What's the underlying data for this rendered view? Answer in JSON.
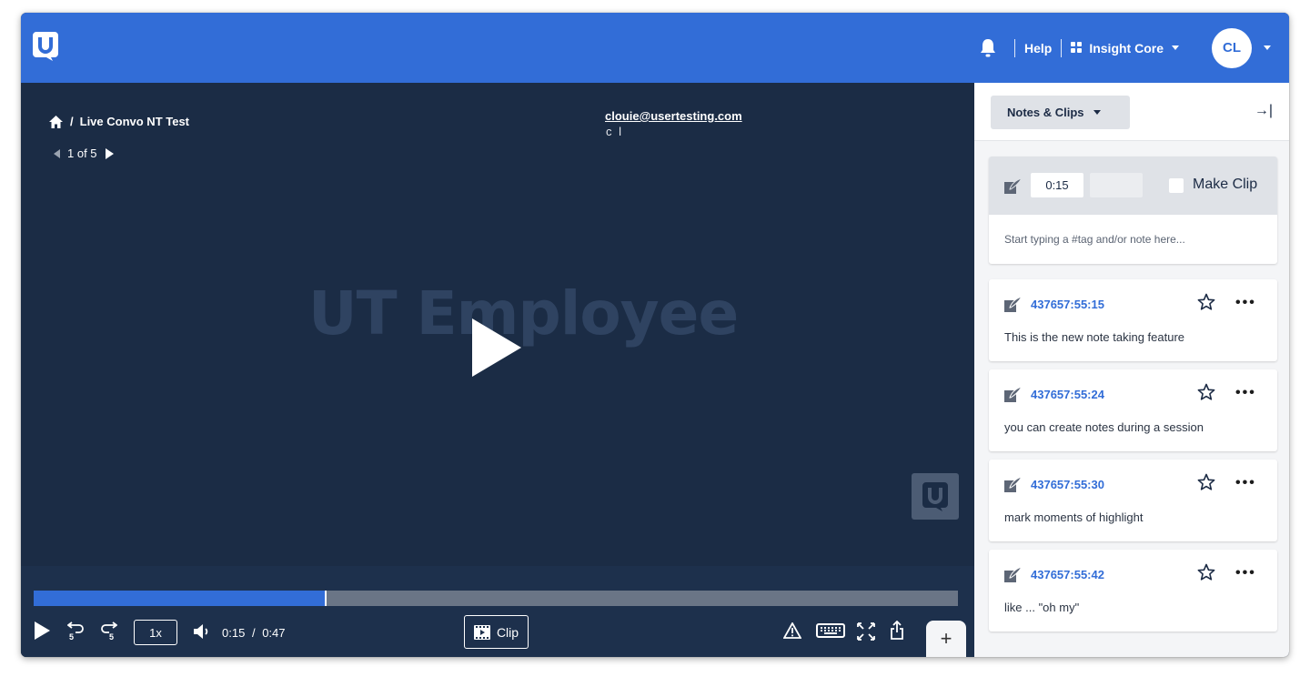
{
  "header": {
    "help_label": "Help",
    "workspace_label": "Insight Core",
    "avatar_initials": "CL"
  },
  "video": {
    "breadcrumb_title": "Live Convo NT Test",
    "pager_text": "1 of 5",
    "participant_email": "clouie@usertesting.com",
    "participant_initials": "c l",
    "watermark_text": "UT Employee",
    "progress_fraction": 0.315,
    "speed_label": "1x",
    "current_time": "0:15",
    "time_separator": "/",
    "duration": "0:47",
    "clip_label": "Clip",
    "add_label": "+"
  },
  "panel": {
    "view_dropdown_label": "Notes & Clips",
    "collapse_label": "→|",
    "composer": {
      "start_time": "0:15",
      "end_time": "",
      "make_clip_label": "Make Clip",
      "make_clip_checked": false,
      "note_placeholder": "Start typing a #tag and/or note here..."
    },
    "notes": [
      {
        "timestamp": "437657:55:15",
        "text": "This is the new note taking feature"
      },
      {
        "timestamp": "437657:55:24",
        "text": "you can create notes during a session"
      },
      {
        "timestamp": "437657:55:30",
        "text": "mark moments of highlight"
      },
      {
        "timestamp": "437657:55:42",
        "text": "like ... \"oh my\""
      }
    ]
  },
  "colors": {
    "brand_blue": "#326dd7",
    "video_bg": "#1b2c45",
    "panel_bg": "#f4f5f7"
  }
}
